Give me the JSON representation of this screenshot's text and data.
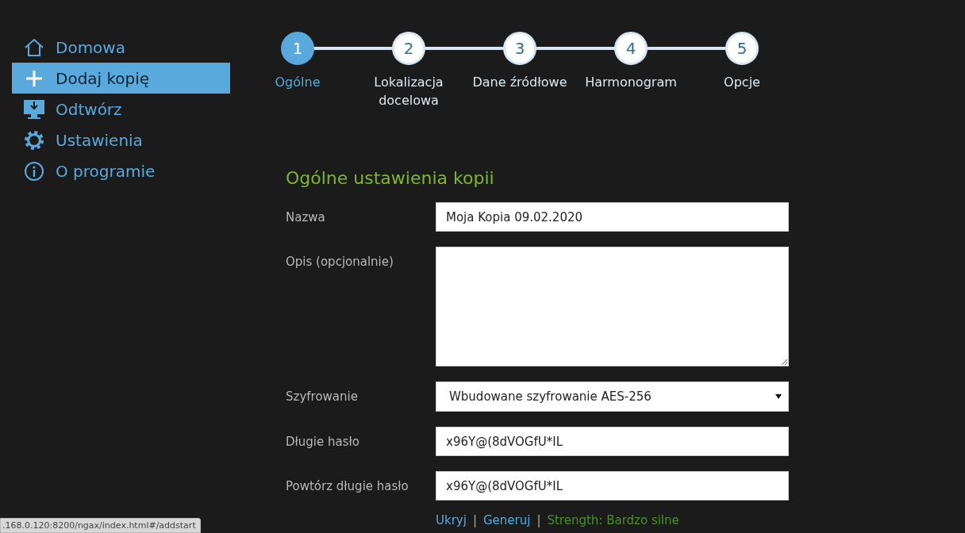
{
  "sidebar": {
    "items": [
      {
        "label": "Domowa",
        "selected": false
      },
      {
        "label": "Dodaj kopię",
        "selected": true
      },
      {
        "label": "Odtwórz",
        "selected": false
      },
      {
        "label": "Ustawienia",
        "selected": false
      },
      {
        "label": "O programie",
        "selected": false
      }
    ]
  },
  "steps": [
    {
      "number": "1",
      "label": "Ogólne",
      "selected": true
    },
    {
      "number": "2",
      "label": "Lokalizacja docelowa",
      "selected": false
    },
    {
      "number": "3",
      "label": "Dane źródłowe",
      "selected": false
    },
    {
      "number": "4",
      "label": "Harmonogram",
      "selected": false
    },
    {
      "number": "5",
      "label": "Opcje",
      "selected": false
    }
  ],
  "form": {
    "title": "Ogólne ustawienia kopii",
    "fields": [
      {
        "kind": "text",
        "label": "Nazwa",
        "value": "Moja Kopia 09.02.2020"
      },
      {
        "kind": "textarea",
        "label": "Opis (opcjonalnie)"
      },
      {
        "kind": "select",
        "label": "Szyfrowanie",
        "value": "Wbudowane szyfrowanie AES-256"
      },
      {
        "kind": "text",
        "label": "Długie hasło",
        "value": "x96Y@(8dVOGfU*IL"
      },
      {
        "kind": "text",
        "label": "Powtórz długie hasło",
        "value": "x96Y@(8dVOGfU*IL"
      }
    ],
    "links": [
      "Ukryj",
      "Generuj"
    ],
    "separator": "|",
    "strength": "Strength: Bardzo silne"
  },
  "status_bar": ".168.0.120:8200/ngax/index.html#/addstart"
}
